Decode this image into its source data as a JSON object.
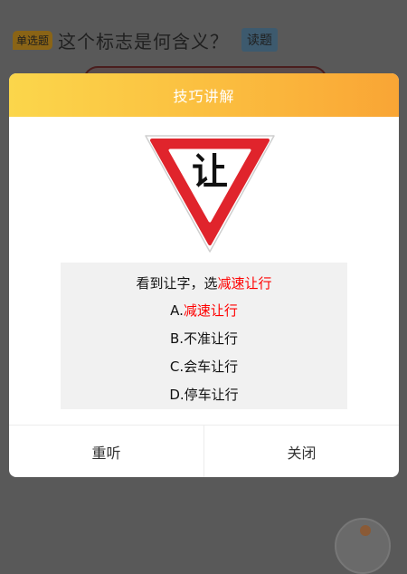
{
  "question": {
    "type_badge": "单选题",
    "title": "这个标志是何含义？",
    "read_button": "读题"
  },
  "modal": {
    "title": "技巧讲解",
    "sign_text": "让",
    "tip": {
      "prefix": "看到让字，选",
      "highlight": "减速让行"
    },
    "options": [
      {
        "letter": "A.",
        "text": "减速让行",
        "highlight": true
      },
      {
        "letter": "B.",
        "text": "不准让行",
        "highlight": false
      },
      {
        "letter": "C.",
        "text": "会车让行",
        "highlight": false
      },
      {
        "letter": "D.",
        "text": "停车让行",
        "highlight": false
      }
    ],
    "replay_button": "重听",
    "close_button": "关闭"
  },
  "colors": {
    "header_start": "#fbd64b",
    "header_end": "#f9a535",
    "highlight": "#ff0000",
    "sign_border": "#e0242c",
    "overlay": "#595959"
  }
}
